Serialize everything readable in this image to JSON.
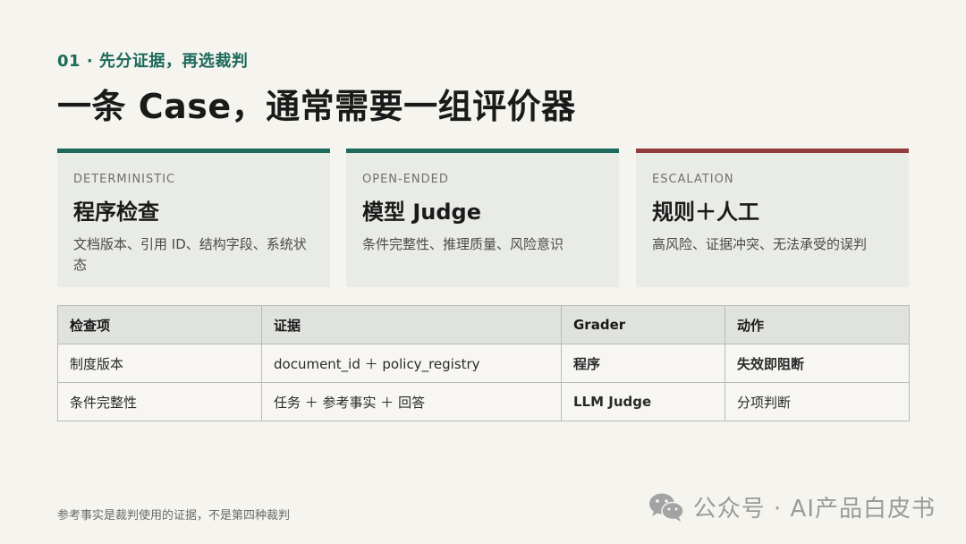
{
  "eyebrow": "01 · 先分证据，再选裁判",
  "title": "一条 Case，通常需要一组评价器",
  "cards": [
    {
      "tag": "DETERMINISTIC",
      "heading": "程序检查",
      "desc": "文档版本、引用 ID、结构字段、系统状态"
    },
    {
      "tag": "OPEN-ENDED",
      "heading": "模型 Judge",
      "desc": "条件完整性、推理质量、风险意识"
    },
    {
      "tag": "ESCALATION",
      "heading": "规则＋人工",
      "desc": "高风险、证据冲突、无法承受的误判"
    }
  ],
  "table": {
    "headers": [
      "检查项",
      "证据",
      "Grader",
      "动作"
    ],
    "rows": [
      [
        "制度版本",
        "document_id ＋ policy_registry",
        "程序",
        "失效即阻断"
      ],
      [
        "条件完整性",
        "任务 ＋ 参考事实 ＋ 回答",
        "LLM Judge",
        "分项判断"
      ]
    ]
  },
  "footnote": "参考事实是裁判使用的证据，不是第四种裁判",
  "watermark": {
    "text": "公众号 · AI产品白皮书",
    "icon": "wechat-icon"
  },
  "colors": {
    "accent": "#1e6a5c",
    "alert": "#943c3c",
    "background": "#f5f4ef"
  }
}
